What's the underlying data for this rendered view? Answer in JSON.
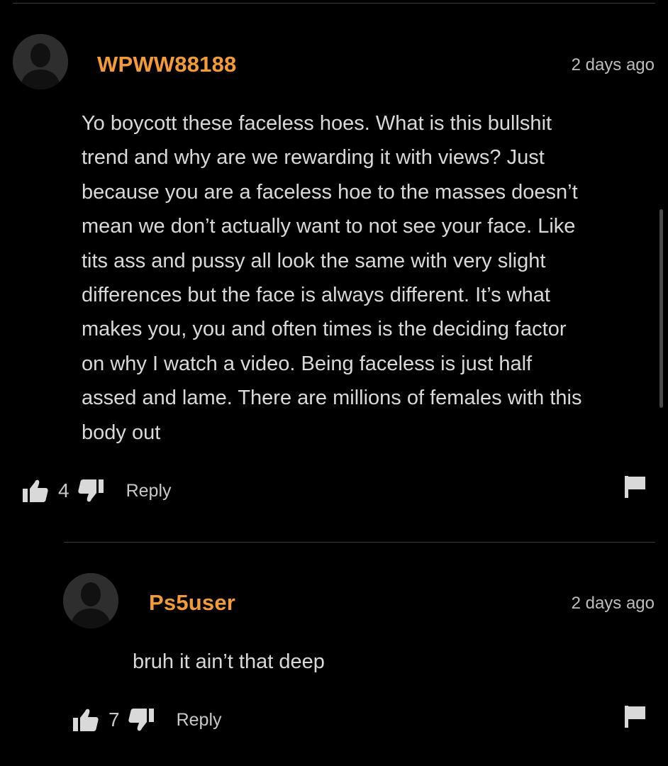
{
  "comments": [
    {
      "username": "WPWW88188",
      "timestamp": "2 days ago",
      "text_lines": [
        "Yo boycott these faceless hoes. What is this bullshit",
        "trend and why are we rewarding it with views? Just",
        "because you are a faceless hoe to the masses doesn’t",
        "mean we don’t actually want to not see your face. Like",
        "tits ass and pussy all look the same with very slight",
        "differences but the face is always different. It’s what",
        "makes you, you and often times is the deciding factor",
        "on why I watch a video. Being faceless is just half",
        "assed and lame. There are millions of females with this",
        "body out"
      ],
      "likes": "4",
      "reply_label": "Reply"
    },
    {
      "username": "Ps5user",
      "timestamp": "2 days ago",
      "text_lines": [
        "bruh it ain’t that deep"
      ],
      "likes": "7",
      "reply_label": "Reply"
    }
  ],
  "icons": {
    "avatar": "user-silhouette-icon",
    "like": "thumbs-up-icon",
    "dislike": "thumbs-down-icon",
    "flag": "flag-icon"
  },
  "colors": {
    "background": "#000000",
    "username": "#f29b38",
    "text": "#d9d9d9",
    "meta": "#bdbdbd"
  }
}
